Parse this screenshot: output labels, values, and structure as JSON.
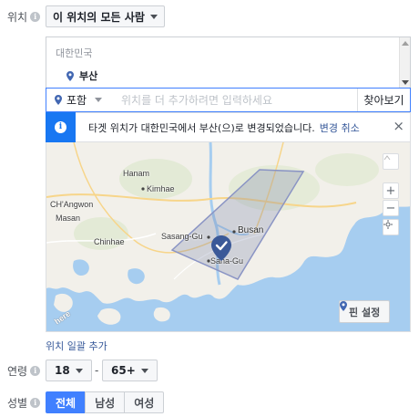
{
  "location": {
    "label": "위치",
    "audience_dropdown": "이 위치의 모든 사람",
    "country": "대한민국",
    "city": "부산",
    "include_selector": "포함",
    "search_placeholder": "위치를 더 추가하려면 입력하세요",
    "browse_button": "찾아보기",
    "bulk_add_link": "위치 일괄 추가"
  },
  "notice": {
    "text": "타겟 위치가 대한민국에서 부산(으)로 변경되었습니다.",
    "undo_link": "변경 취소",
    "close": "×"
  },
  "map": {
    "labels": {
      "hanam": "Hanam",
      "kimhae": "Kimhae",
      "changwon": "CH'Angwon",
      "masan": "Masan",
      "chinhae": "Chinhae",
      "busan": "Busan",
      "sasang": "Sasang-Gu",
      "saha": "Saha-Gu"
    },
    "zoom_in": "+",
    "zoom_out": "−",
    "pin_button": "핀 설정",
    "logo": "here"
  },
  "age": {
    "label": "연령",
    "min": "18",
    "separator": "-",
    "max": "65+"
  },
  "gender": {
    "label": "성별",
    "options": [
      "전체",
      "남성",
      "여성"
    ],
    "selected": "전체"
  },
  "colors": {
    "accent": "#4080ff",
    "link": "#365899",
    "water": "#a6cdf0",
    "land": "#f2f0ea"
  }
}
